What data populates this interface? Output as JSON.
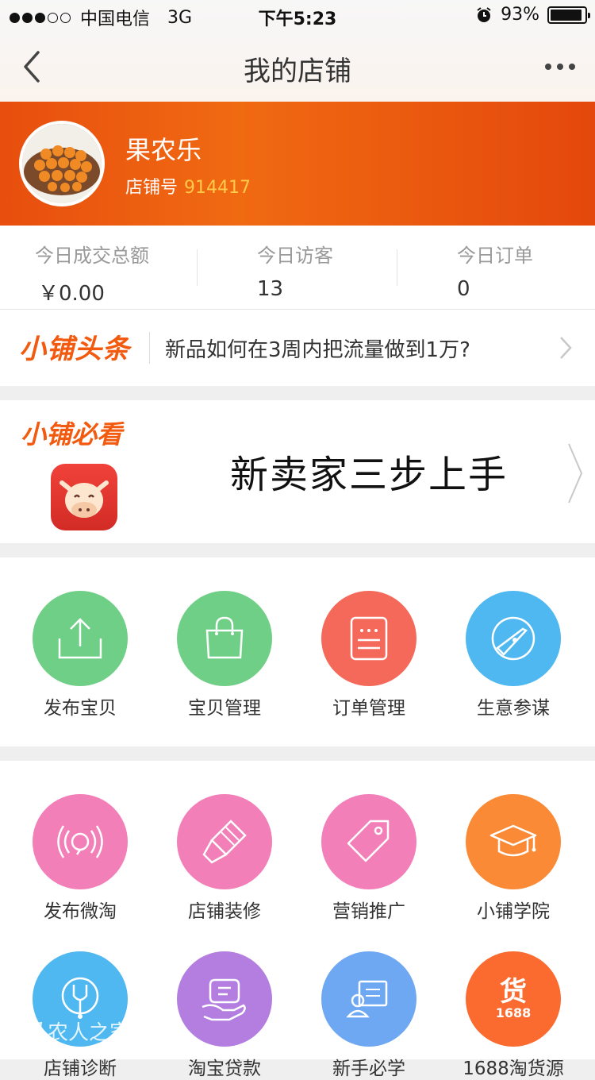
{
  "status_bar": {
    "carrier": "中国电信",
    "network": "3G",
    "time": "下午5:23",
    "battery": "93%",
    "battery_level": 0.93
  },
  "nav": {
    "title": "我的店铺"
  },
  "shop": {
    "name": "果农乐",
    "id_label": "店铺号",
    "id": "914417"
  },
  "stats": [
    {
      "label": "今日成交总额",
      "value": "￥0.00"
    },
    {
      "label": "今日访客",
      "value": "13"
    },
    {
      "label": "今日订单",
      "value": "0"
    }
  ],
  "headline": {
    "logo": "小铺头条",
    "text": "新品如何在3周内把流量做到1万?"
  },
  "must_read": {
    "logo": "小铺必看",
    "title": "新卖家三步上手"
  },
  "grid1": [
    {
      "label": "发布宝贝",
      "icon": "upload-icon",
      "color": "#6fcf86"
    },
    {
      "label": "宝贝管理",
      "icon": "bag-icon",
      "color": "#6fcf86"
    },
    {
      "label": "订单管理",
      "icon": "order-list-icon",
      "color": "#f5695a"
    },
    {
      "label": "生意参谋",
      "icon": "compass-icon",
      "color": "#50b8f0"
    }
  ],
  "grid2": [
    {
      "label": "发布微淘",
      "icon": "broadcast-icon",
      "color": "#f27fb8"
    },
    {
      "label": "店铺装修",
      "icon": "brush-icon",
      "color": "#f27fb8"
    },
    {
      "label": "营销推广",
      "icon": "tag-icon",
      "color": "#f27fb8"
    },
    {
      "label": "小铺学院",
      "icon": "graduation-cap-icon",
      "color": "#fa8a36"
    },
    {
      "label": "店铺诊断",
      "icon": "stethoscope-icon",
      "color": "#50b8f0"
    },
    {
      "label": "淘宝贷款",
      "icon": "loan-hand-icon",
      "color": "#b37ee0"
    },
    {
      "label": "新手必学",
      "icon": "id-card-icon",
      "color": "#6fa8f2"
    },
    {
      "label": "1688淘货源",
      "icon": "goods-1688-icon",
      "color": "#fb6a2e",
      "badge_text": "货",
      "badge_sub": "1688"
    }
  ],
  "watermark": "农人之家"
}
